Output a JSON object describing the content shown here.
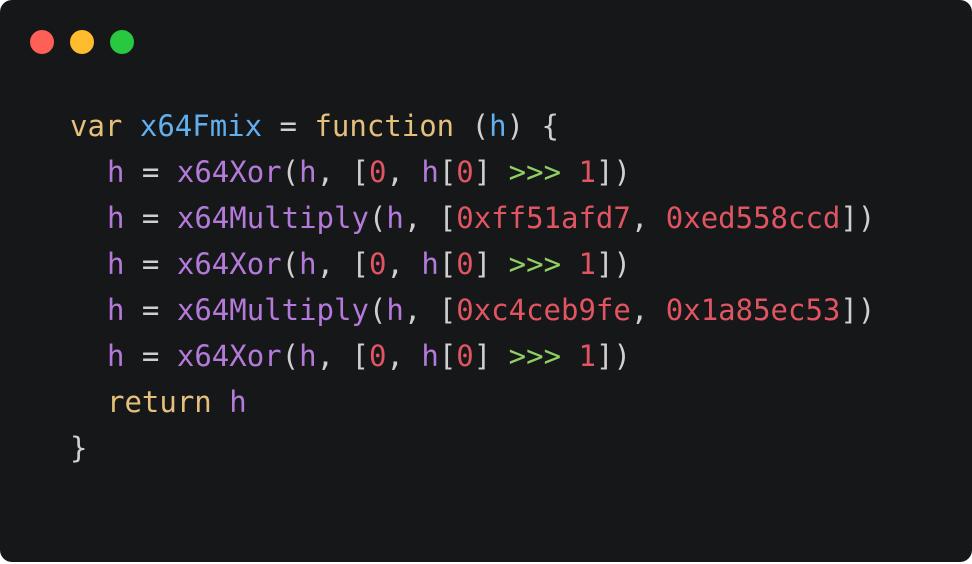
{
  "window": {
    "controls": [
      {
        "name": "close",
        "color": "#fe5f57"
      },
      {
        "name": "minimize",
        "color": "#febc2e"
      },
      {
        "name": "maximize",
        "color": "#28c840"
      }
    ]
  },
  "colors": {
    "background": "#161719",
    "keyword": "#e5c07b",
    "identifier": "#61afef",
    "variable": "#b47ad9",
    "function": "#b47ad9",
    "number": "#e05561",
    "operator_shift": "#8fcf63",
    "punctuation": "#cfcfcf",
    "operator": "#cfcfcf"
  },
  "code": {
    "lines": [
      {
        "indent": false,
        "tokens": [
          {
            "t": "var",
            "k": "keyword"
          },
          {
            "t": " ",
            "k": "plain"
          },
          {
            "t": "x64Fmix",
            "k": "identifier"
          },
          {
            "t": " = ",
            "k": "operator"
          },
          {
            "t": "function",
            "k": "keyword"
          },
          {
            "t": " (",
            "k": "punctuation"
          },
          {
            "t": "h",
            "k": "identifier"
          },
          {
            "t": ") {",
            "k": "punctuation"
          }
        ]
      },
      {
        "indent": true,
        "tokens": [
          {
            "t": "h",
            "k": "variable"
          },
          {
            "t": " = ",
            "k": "operator"
          },
          {
            "t": "x64Xor",
            "k": "function"
          },
          {
            "t": "(",
            "k": "punctuation"
          },
          {
            "t": "h",
            "k": "variable"
          },
          {
            "t": ", [",
            "k": "punctuation"
          },
          {
            "t": "0",
            "k": "number"
          },
          {
            "t": ", ",
            "k": "punctuation"
          },
          {
            "t": "h",
            "k": "variable"
          },
          {
            "t": "[",
            "k": "punctuation"
          },
          {
            "t": "0",
            "k": "number"
          },
          {
            "t": "] ",
            "k": "punctuation"
          },
          {
            "t": ">>>",
            "k": "operator_shift"
          },
          {
            "t": " ",
            "k": "plain"
          },
          {
            "t": "1",
            "k": "number"
          },
          {
            "t": "])",
            "k": "punctuation"
          }
        ]
      },
      {
        "indent": true,
        "tokens": [
          {
            "t": "h",
            "k": "variable"
          },
          {
            "t": " = ",
            "k": "operator"
          },
          {
            "t": "x64Multiply",
            "k": "function"
          },
          {
            "t": "(",
            "k": "punctuation"
          },
          {
            "t": "h",
            "k": "variable"
          },
          {
            "t": ", [",
            "k": "punctuation"
          },
          {
            "t": "0xff51afd7",
            "k": "number"
          },
          {
            "t": ", ",
            "k": "punctuation"
          },
          {
            "t": "0xed558ccd",
            "k": "number"
          },
          {
            "t": "])",
            "k": "punctuation"
          }
        ]
      },
      {
        "indent": true,
        "tokens": [
          {
            "t": "h",
            "k": "variable"
          },
          {
            "t": " = ",
            "k": "operator"
          },
          {
            "t": "x64Xor",
            "k": "function"
          },
          {
            "t": "(",
            "k": "punctuation"
          },
          {
            "t": "h",
            "k": "variable"
          },
          {
            "t": ", [",
            "k": "punctuation"
          },
          {
            "t": "0",
            "k": "number"
          },
          {
            "t": ", ",
            "k": "punctuation"
          },
          {
            "t": "h",
            "k": "variable"
          },
          {
            "t": "[",
            "k": "punctuation"
          },
          {
            "t": "0",
            "k": "number"
          },
          {
            "t": "] ",
            "k": "punctuation"
          },
          {
            "t": ">>>",
            "k": "operator_shift"
          },
          {
            "t": " ",
            "k": "plain"
          },
          {
            "t": "1",
            "k": "number"
          },
          {
            "t": "])",
            "k": "punctuation"
          }
        ]
      },
      {
        "indent": true,
        "tokens": [
          {
            "t": "h",
            "k": "variable"
          },
          {
            "t": " = ",
            "k": "operator"
          },
          {
            "t": "x64Multiply",
            "k": "function"
          },
          {
            "t": "(",
            "k": "punctuation"
          },
          {
            "t": "h",
            "k": "variable"
          },
          {
            "t": ", [",
            "k": "punctuation"
          },
          {
            "t": "0xc4ceb9fe",
            "k": "number"
          },
          {
            "t": ", ",
            "k": "punctuation"
          },
          {
            "t": "0x1a85ec53",
            "k": "number"
          },
          {
            "t": "])",
            "k": "punctuation"
          }
        ]
      },
      {
        "indent": true,
        "tokens": [
          {
            "t": "h",
            "k": "variable"
          },
          {
            "t": " = ",
            "k": "operator"
          },
          {
            "t": "x64Xor",
            "k": "function"
          },
          {
            "t": "(",
            "k": "punctuation"
          },
          {
            "t": "h",
            "k": "variable"
          },
          {
            "t": ", [",
            "k": "punctuation"
          },
          {
            "t": "0",
            "k": "number"
          },
          {
            "t": ", ",
            "k": "punctuation"
          },
          {
            "t": "h",
            "k": "variable"
          },
          {
            "t": "[",
            "k": "punctuation"
          },
          {
            "t": "0",
            "k": "number"
          },
          {
            "t": "] ",
            "k": "punctuation"
          },
          {
            "t": ">>>",
            "k": "operator_shift"
          },
          {
            "t": " ",
            "k": "plain"
          },
          {
            "t": "1",
            "k": "number"
          },
          {
            "t": "])",
            "k": "punctuation"
          }
        ]
      },
      {
        "indent": true,
        "tokens": [
          {
            "t": "return",
            "k": "keyword"
          },
          {
            "t": " ",
            "k": "plain"
          },
          {
            "t": "h",
            "k": "variable"
          }
        ]
      },
      {
        "indent": false,
        "tokens": [
          {
            "t": "}",
            "k": "punctuation"
          }
        ]
      }
    ]
  }
}
